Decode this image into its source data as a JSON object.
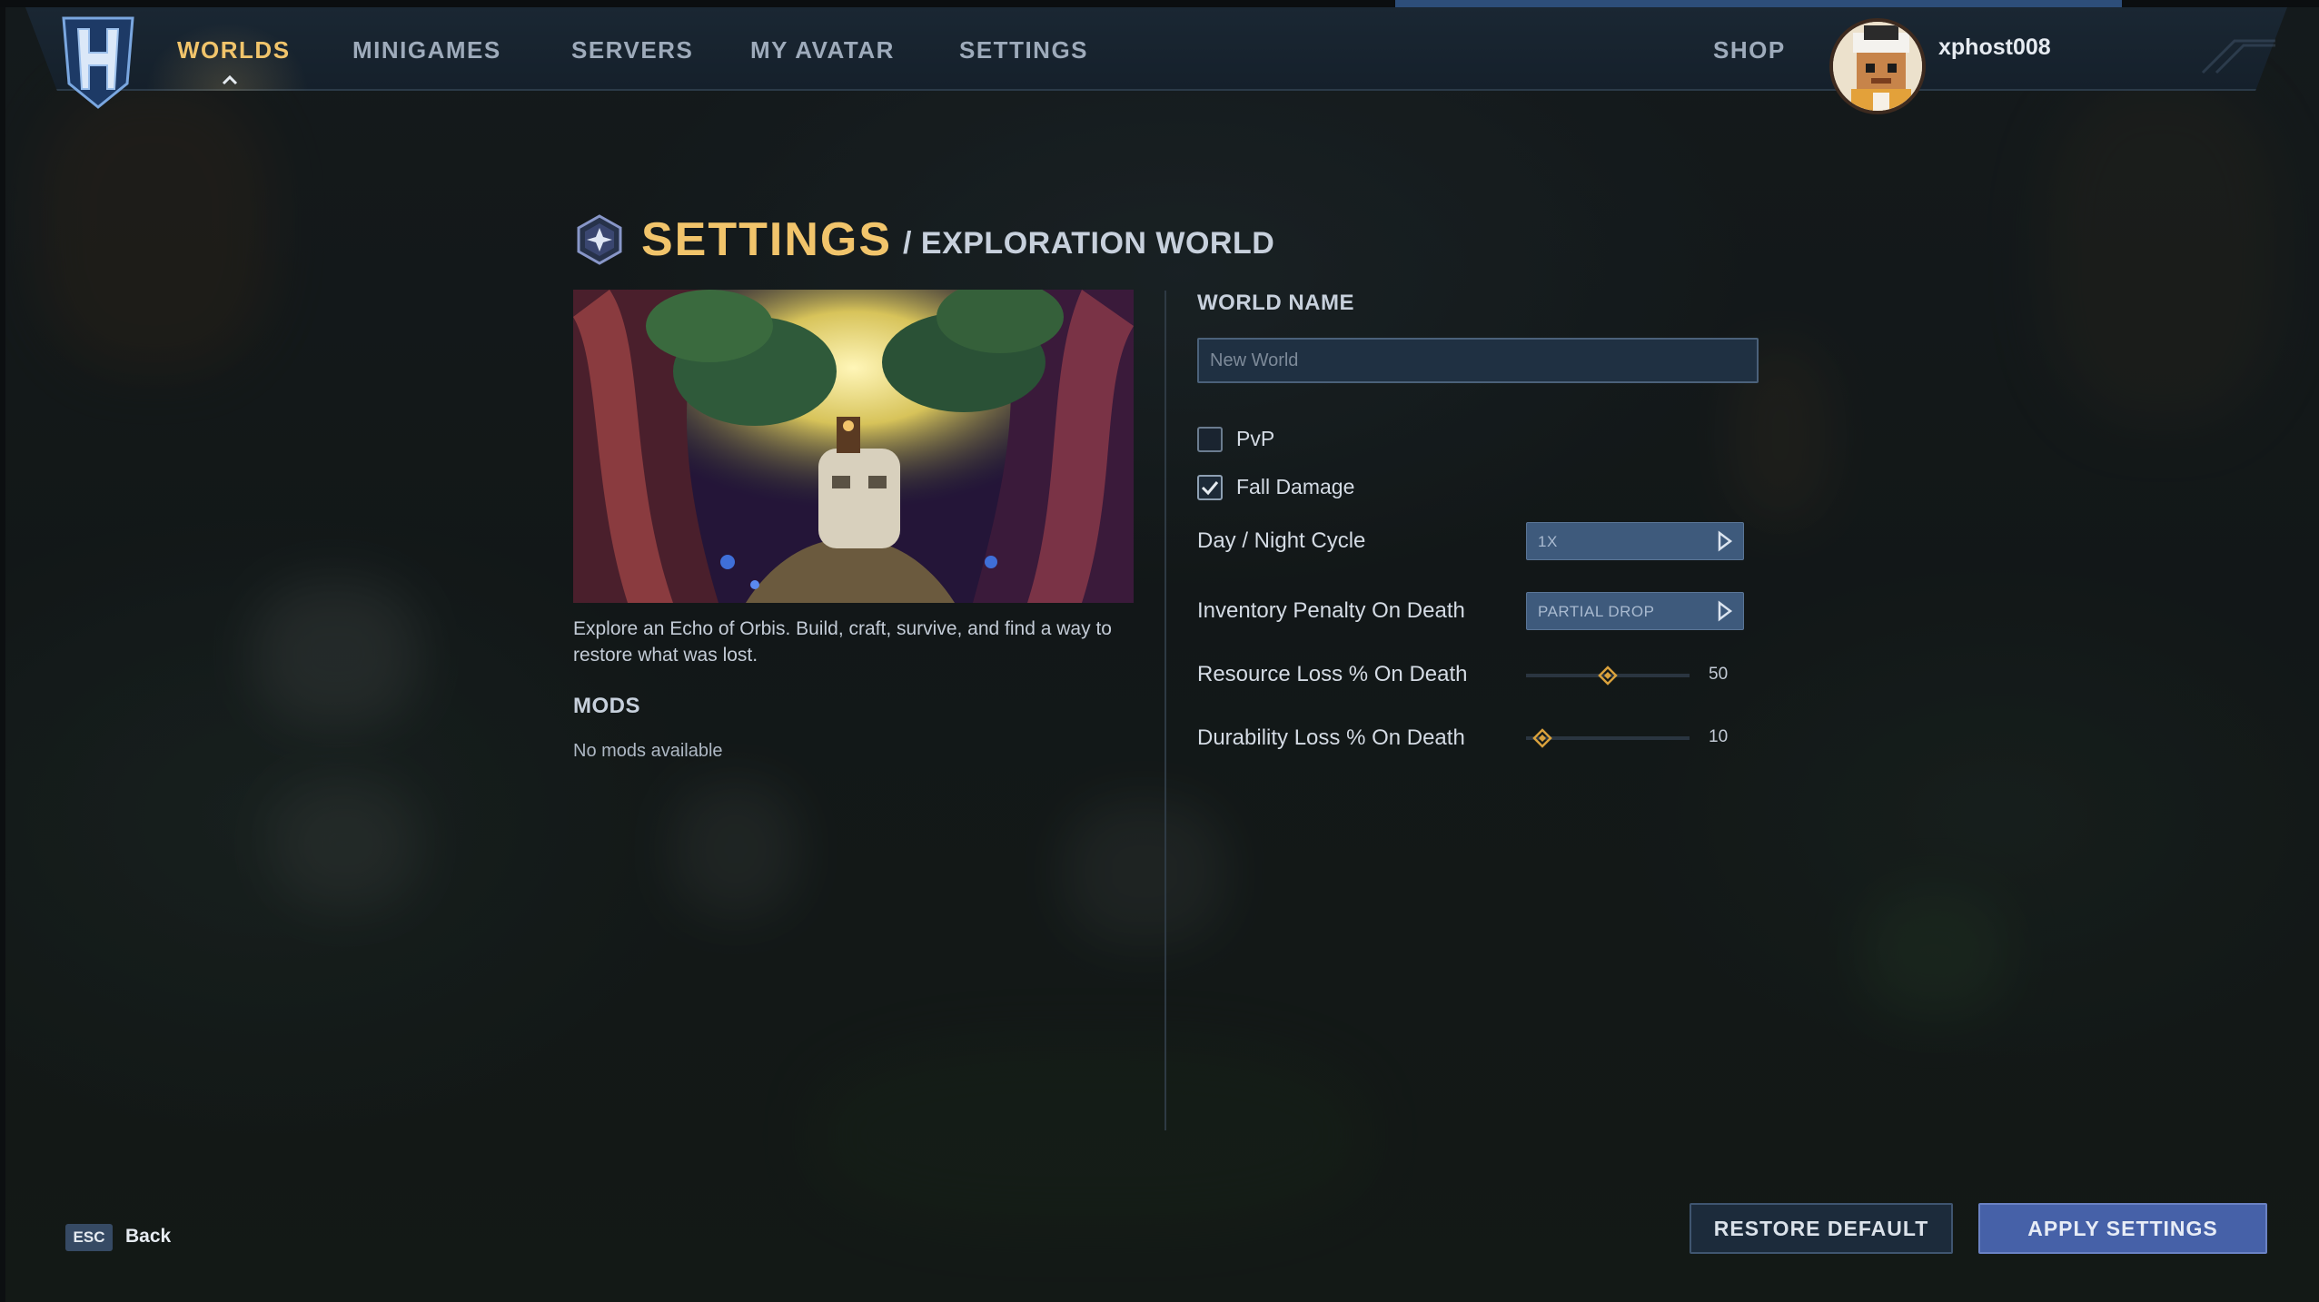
{
  "nav": {
    "items": [
      {
        "label": "WORLDS",
        "active": true
      },
      {
        "label": "MINIGAMES",
        "active": false
      },
      {
        "label": "SERVERS",
        "active": false
      },
      {
        "label": "MY AVATAR",
        "active": false
      },
      {
        "label": "SETTINGS",
        "active": false
      }
    ],
    "shop_label": "SHOP",
    "username": "xphost008"
  },
  "header": {
    "title": "SETTINGS",
    "subtitle": "/ EXPLORATION WORLD"
  },
  "world": {
    "description": "Explore an Echo of Orbis. Build, craft, survive, and find a way to restore what was lost.",
    "mods_title": "MODS",
    "mods_empty": "No mods available"
  },
  "settings": {
    "world_name_label": "WORLD NAME",
    "world_name_placeholder": "New World",
    "pvp": {
      "label": "PvP",
      "checked": false
    },
    "fall_damage": {
      "label": "Fall Damage",
      "checked": true
    },
    "day_night": {
      "label": "Day / Night Cycle",
      "value": "1X"
    },
    "inventory_penalty": {
      "label": "Inventory Penalty On Death",
      "value": "PARTIAL DROP"
    },
    "resource_loss": {
      "label": "Resource Loss % On Death",
      "value": "50",
      "fraction": 0.5
    },
    "durability_loss": {
      "label": "Durability Loss % On Death",
      "value": "10",
      "fraction": 0.1
    }
  },
  "footer": {
    "esc_key": "ESC",
    "back_label": "Back",
    "restore_label": "RESTORE DEFAULT",
    "apply_label": "APPLY SETTINGS"
  },
  "colors": {
    "accent_gold": "#f1c46b",
    "apply_blue": "#4661a8",
    "selector_blue": "#3e5a7c"
  }
}
